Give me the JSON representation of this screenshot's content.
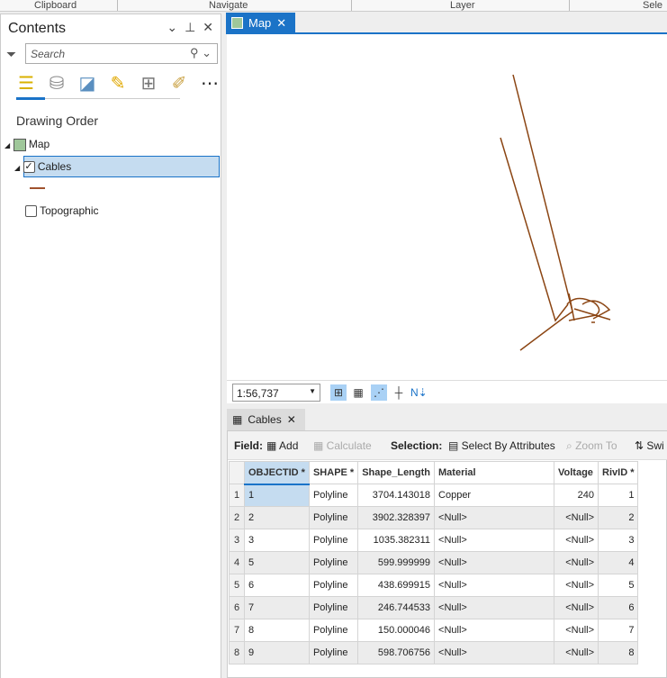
{
  "ribbon": {
    "groups": [
      "Clipboard",
      "Navigate",
      "Layer",
      "Sele"
    ]
  },
  "contents": {
    "title": "Contents",
    "search_placeholder": "Search",
    "heading": "Drawing Order",
    "tree": {
      "map": "Map",
      "layer1": "Cables",
      "layer2": "Topographic"
    },
    "cables_checked": true,
    "topographic_checked": false,
    "symbol_color": "#a0522d"
  },
  "map_tab": {
    "label": "Map"
  },
  "map": {
    "scale": "1:56,737",
    "line_color": "#8b4513"
  },
  "table_tab": {
    "label": "Cables"
  },
  "table_toolbar": {
    "field_label": "Field:",
    "add": "Add",
    "calculate": "Calculate",
    "selection_label": "Selection:",
    "select_by_attributes": "Select By Attributes",
    "zoom_to": "Zoom To",
    "switch": "Swi"
  },
  "table": {
    "columns": [
      "OBJECTID *",
      "SHAPE *",
      "Shape_Length",
      "Material",
      "Voltage",
      "RivID *"
    ],
    "rows": [
      [
        "1",
        "1",
        "Polyline",
        "3704.143018",
        "Copper",
        "240",
        "1"
      ],
      [
        "2",
        "2",
        "Polyline",
        "3902.328397",
        "<Null>",
        "<Null>",
        "2"
      ],
      [
        "3",
        "3",
        "Polyline",
        "1035.382311",
        "<Null>",
        "<Null>",
        "3"
      ],
      [
        "4",
        "5",
        "Polyline",
        "599.999999",
        "<Null>",
        "<Null>",
        "4"
      ],
      [
        "5",
        "6",
        "Polyline",
        "438.699915",
        "<Null>",
        "<Null>",
        "5"
      ],
      [
        "6",
        "7",
        "Polyline",
        "246.744533",
        "<Null>",
        "<Null>",
        "6"
      ],
      [
        "7",
        "8",
        "Polyline",
        "150.000046",
        "<Null>",
        "<Null>",
        "7"
      ],
      [
        "8",
        "9",
        "Polyline",
        "598.706756",
        "<Null>",
        "<Null>",
        "8"
      ]
    ]
  }
}
